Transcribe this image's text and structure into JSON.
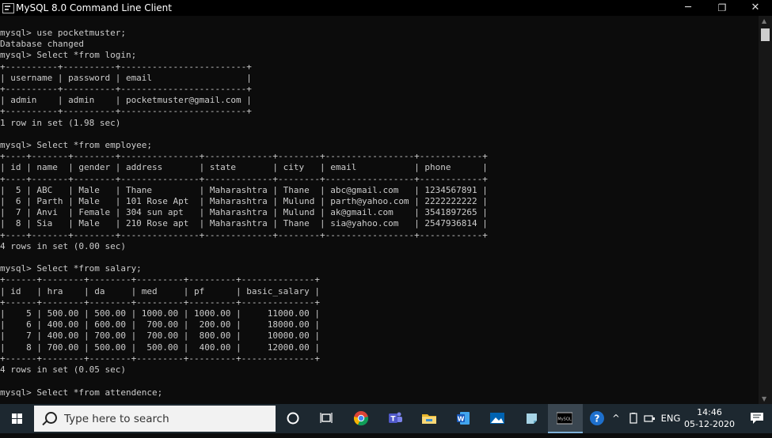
{
  "window": {
    "title": "MySQL 8.0 Command Line Client",
    "minimize_glyph": "─",
    "restore_glyph": "❐",
    "close_glyph": "✕"
  },
  "console": {
    "text": "mysql> use pocketmuster;\nDatabase changed\nmysql> Select *from login;\n+----------+----------+------------------------+\n| username | password | email                  |\n+----------+----------+------------------------+\n| admin    | admin    | pocketmuster@gmail.com |\n+----------+----------+------------------------+\n1 row in set (1.98 sec)\n\nmysql> Select *from employee;\n+----+-------+--------+---------------+-------------+--------+-----------------+------------+\n| id | name  | gender | address       | state       | city   | email           | phone      |\n+----+-------+--------+---------------+-------------+--------+-----------------+------------+\n|  5 | ABC   | Male   | Thane         | Maharashtra | Thane  | abc@gmail.com   | 1234567891 |\n|  6 | Parth | Male   | 101 Rose Apt  | Maharashtra | Mulund | parth@yahoo.com | 2222222222 |\n|  7 | Anvi  | Female | 304 sun apt   | Maharashtra | Mulund | ak@gmail.com    | 3541897265 |\n|  8 | Sia   | Male   | 210 Rose apt  | Maharashtra | Thane  | sia@yahoo.com   | 2547936814 |\n+----+-------+--------+---------------+-------------+--------+-----------------+------------+\n4 rows in set (0.00 sec)\n\nmysql> Select *from salary;\n+------+--------+--------+---------+---------+--------------+\n| id   | hra    | da     | med     | pf      | basic_salary |\n+------+--------+--------+---------+---------+--------------+\n|    5 | 500.00 | 500.00 | 1000.00 | 1000.00 |     11000.00 |\n|    6 | 400.00 | 600.00 |  700.00 |  200.00 |     18000.00 |\n|    7 | 400.00 | 700.00 |  700.00 |  800.00 |     10000.00 |\n|    8 | 700.00 | 500.00 |  500.00 |  400.00 |     12000.00 |\n+------+--------+--------+---------+---------+--------------+\n4 rows in set (0.05 sec)\n\nmysql> Select *from attendence;"
  },
  "taskbar": {
    "search_placeholder": "Type here to search",
    "language": "ENG",
    "time": "14:46",
    "date": "05-12-2020",
    "tray_chevron": "^"
  },
  "colors": {
    "console_bg": "#0c0c0c",
    "console_fg": "#cccccc",
    "taskbar_bg": "#1d2830",
    "accent": "#7fb0d8"
  },
  "icons": [
    "app-icon",
    "windows-start-icon",
    "search-icon",
    "cortana-icon",
    "task-view-icon",
    "chrome-icon",
    "teams-icon",
    "file-explorer-icon",
    "word-icon",
    "photos-icon",
    "sticky-notes-icon",
    "mysql-icon",
    "help-icon",
    "battery-icon",
    "network-icon",
    "volume-icon",
    "notification-icon"
  ]
}
